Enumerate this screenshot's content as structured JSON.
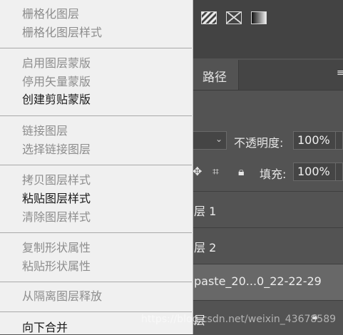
{
  "panel": {
    "tab_label": "路径",
    "tab_menu_icon": "≡",
    "opacity_label": "不透明度:",
    "opacity_value": "100%",
    "fill_label": "填充:",
    "fill_value": "100%",
    "layers": [
      {
        "name": "层 1"
      },
      {
        "name": "层 2"
      },
      {
        "name": "paste_20...0_22-22-29"
      },
      {
        "name": "层"
      }
    ]
  },
  "menu": {
    "items": [
      {
        "label": "栅格化图层",
        "enabled": false
      },
      {
        "label": "栅格化图层样式",
        "enabled": false
      },
      {
        "label": "启用图层蒙版",
        "enabled": false
      },
      {
        "label": "停用矢量蒙版",
        "enabled": false
      },
      {
        "label": "创建剪贴蒙版",
        "enabled": true
      },
      {
        "label": "链接图层",
        "enabled": false
      },
      {
        "label": "选择链接图层",
        "enabled": false
      },
      {
        "label": "拷贝图层样式",
        "enabled": false
      },
      {
        "label": "粘贴图层样式",
        "enabled": true
      },
      {
        "label": "清除图层样式",
        "enabled": false
      },
      {
        "label": "复制形状属性",
        "enabled": false
      },
      {
        "label": "粘贴形状属性",
        "enabled": false
      },
      {
        "label": "从隔离图层释放",
        "enabled": false
      },
      {
        "label": "向下合并",
        "enabled": true
      }
    ]
  },
  "watermark": "https://blog.csdn.net/weixin_43678589"
}
